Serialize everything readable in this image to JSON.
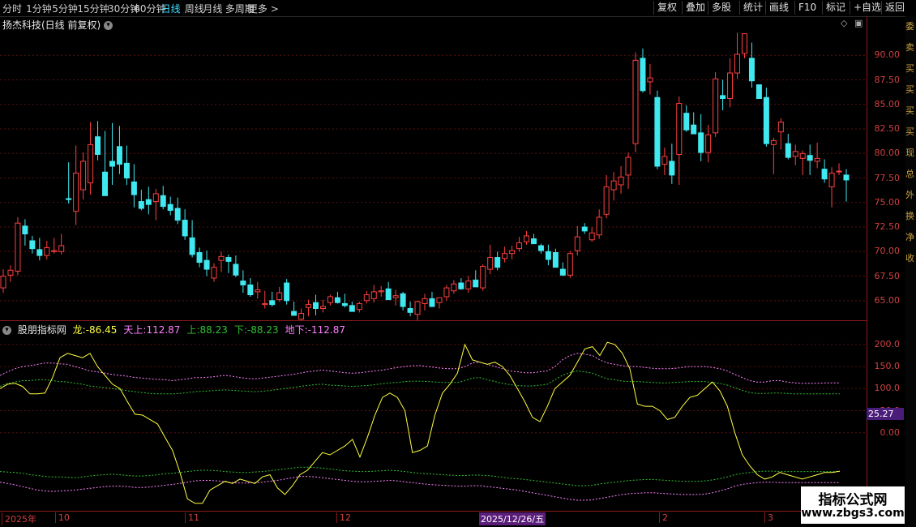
{
  "periods": [
    "分时",
    "1分钟",
    "5分钟",
    "15分钟",
    "30分钟",
    "60分钟",
    "日线",
    "周线",
    "月线",
    "多周期",
    "更多 >"
  ],
  "active_period": "日线",
  "toolbar_right": [
    "复权",
    "叠加",
    "多股",
    "统计",
    "画线",
    "F10",
    "标记",
    "+自选",
    "返回"
  ],
  "stock_title": "扬杰科技(日线 前复权)",
  "price_axis": [
    "90.00",
    "87.50",
    "85.00",
    "82.50",
    "80.00",
    "77.50",
    "75.00",
    "72.50",
    "70.00",
    "67.50",
    "65.00"
  ],
  "indicator": {
    "name": "股朋指标网",
    "items": [
      {
        "label": "龙:",
        "value": "-86.45",
        "color": "#ffff40"
      },
      {
        "label": "天上:",
        "value": "112.87",
        "color": "#ff80ff"
      },
      {
        "label": "上:",
        "value": "88.23",
        "color": "#30c030"
      },
      {
        "label": "下:",
        "value": "-88.23",
        "color": "#30c030"
      },
      {
        "label": "地下:",
        "value": "-112.87",
        "color": "#ff80ff"
      }
    ],
    "axis": [
      "200.0",
      "150.0",
      "100.0",
      "50.0",
      "0.00"
    ],
    "current_value": "25.27"
  },
  "date_axis": [
    {
      "label": "2025年"
    },
    {
      "label": "10"
    },
    {
      "label": "11"
    },
    {
      "label": "12"
    },
    {
      "label": "2"
    },
    {
      "label": "3"
    }
  ],
  "date_selected": "2025/12/26/五",
  "watermark": {
    "line1": "指标公式网",
    "line2": "www.zbgs3.com"
  },
  "colors": {
    "up": "#ff4040",
    "down": "#40e8f0",
    "axis": "#8b1a1a",
    "curve": "#ffff40"
  },
  "far_right_glyphs": [
    "委",
    "卖",
    "买",
    "买",
    "买",
    "买",
    "现",
    "总",
    "外",
    "换",
    "净",
    "收"
  ],
  "chart_data": {
    "type": "candlestick",
    "ylim": [
      63,
      92.5
    ],
    "candles": [
      [
        66.3,
        68.2,
        65.8,
        67.5
      ],
      [
        67.6,
        68.6,
        66.9,
        68.1
      ],
      [
        68.0,
        73.5,
        67.6,
        72.9
      ],
      [
        72.6,
        73.3,
        70.6,
        71.8
      ],
      [
        71.1,
        71.6,
        69.8,
        70.3
      ],
      [
        70.2,
        71.4,
        69.1,
        69.6
      ],
      [
        69.6,
        71.1,
        69.2,
        70.4
      ],
      [
        70.0,
        71.4,
        69.8,
        70.1
      ],
      [
        70.0,
        71.8,
        69.7,
        70.6
      ],
      [
        75.4,
        79.1,
        74.9,
        75.3
      ],
      [
        74.1,
        80.8,
        72.7,
        78.0
      ],
      [
        76.3,
        80.1,
        75.3,
        79.2
      ],
      [
        77.0,
        83.2,
        75.8,
        80.9
      ],
      [
        81.7,
        83.3,
        79.3,
        79.9
      ],
      [
        78.1,
        82.3,
        76.9,
        75.7
      ],
      [
        79.2,
        83.1,
        76.8,
        78.7
      ],
      [
        80.7,
        82.8,
        77.9,
        78.9
      ],
      [
        79.0,
        80.8,
        76.8,
        77.5
      ],
      [
        77.1,
        78.9,
        74.5,
        75.8
      ],
      [
        75.1,
        76.3,
        74.2,
        74.4
      ],
      [
        75.3,
        76.6,
        73.8,
        74.8
      ],
      [
        75.1,
        76.4,
        73.2,
        75.9
      ],
      [
        75.7,
        76.7,
        74.3,
        74.6
      ],
      [
        74.8,
        75.6,
        73.7,
        74.2
      ],
      [
        74.4,
        75.5,
        72.8,
        73.2
      ],
      [
        73.2,
        74.3,
        71.2,
        71.6
      ],
      [
        71.4,
        73.2,
        69.4,
        69.7
      ],
      [
        69.9,
        70.4,
        68.4,
        68.9
      ],
      [
        69.1,
        70.1,
        67.5,
        68.2
      ],
      [
        67.3,
        68.8,
        66.9,
        68.4
      ],
      [
        69.1,
        70.0,
        67.9,
        69.5
      ],
      [
        69.4,
        69.7,
        67.8,
        69.0
      ],
      [
        68.7,
        69.6,
        67.4,
        67.6
      ],
      [
        67.0,
        68.1,
        65.8,
        66.6
      ],
      [
        66.6,
        67.3,
        65.4,
        65.6
      ],
      [
        65.9,
        66.9,
        65.2,
        66.1
      ],
      [
        64.6,
        66.0,
        64.2,
        64.7
      ],
      [
        65.0,
        65.9,
        64.4,
        64.6
      ],
      [
        65.1,
        66.4,
        64.9,
        65.8
      ],
      [
        66.8,
        67.2,
        64.6,
        65.0
      ],
      [
        63.9,
        64.9,
        63.7,
        63.5
      ],
      [
        63.1,
        64.2,
        62.7,
        63.7
      ],
      [
        64.3,
        65.1,
        63.4,
        64.6
      ],
      [
        64.8,
        65.6,
        63.5,
        64.2
      ],
      [
        64.2,
        65.1,
        63.8,
        64.4
      ],
      [
        64.8,
        65.6,
        64.5,
        65.4
      ],
      [
        65.3,
        65.9,
        64.7,
        64.8
      ],
      [
        64.7,
        65.7,
        64.3,
        64.5
      ],
      [
        64.5,
        64.9,
        63.9,
        63.9
      ],
      [
        64.1,
        64.9,
        63.8,
        64.7
      ],
      [
        65.0,
        66.0,
        64.7,
        65.6
      ],
      [
        65.2,
        66.6,
        64.8,
        65.9
      ],
      [
        65.9,
        66.5,
        65.4,
        66.0
      ],
      [
        66.2,
        66.9,
        65.5,
        65.1
      ],
      [
        65.3,
        66.1,
        64.5,
        65.5
      ],
      [
        65.7,
        65.9,
        64.0,
        64.4
      ],
      [
        64.2,
        64.9,
        63.4,
        63.8
      ],
      [
        63.6,
        65.0,
        62.8,
        64.9
      ],
      [
        64.7,
        65.7,
        64.0,
        65.2
      ],
      [
        65.2,
        65.9,
        64.6,
        64.4
      ],
      [
        64.8,
        65.3,
        64.2,
        65.3
      ],
      [
        65.4,
        66.6,
        65.0,
        66.3
      ],
      [
        66.0,
        67.1,
        65.7,
        66.7
      ],
      [
        66.8,
        67.3,
        66.1,
        66.2
      ],
      [
        66.2,
        67.5,
        65.8,
        67.0
      ],
      [
        67.1,
        68.1,
        66.6,
        66.4
      ],
      [
        66.3,
        68.7,
        66.0,
        68.5
      ],
      [
        68.2,
        70.7,
        67.7,
        69.4
      ],
      [
        69.4,
        70.0,
        68.1,
        68.4
      ],
      [
        69.3,
        70.5,
        68.9,
        69.8
      ],
      [
        69.8,
        70.6,
        69.2,
        70.1
      ],
      [
        70.3,
        71.5,
        70.0,
        70.9
      ],
      [
        71.0,
        72.1,
        70.7,
        71.6
      ],
      [
        71.3,
        71.8,
        70.8,
        70.8
      ],
      [
        70.6,
        70.8,
        69.8,
        70.1
      ],
      [
        70.0,
        70.7,
        68.6,
        69.2
      ],
      [
        69.9,
        70.3,
        68.8,
        68.4
      ],
      [
        68.2,
        68.9,
        67.5,
        67.6
      ],
      [
        67.6,
        70.1,
        67.3,
        69.8
      ],
      [
        70.1,
        72.6,
        69.6,
        71.5
      ],
      [
        72.5,
        72.9,
        71.8,
        72.1
      ],
      [
        71.2,
        72.5,
        71.0,
        71.9
      ],
      [
        71.7,
        74.3,
        71.3,
        73.5
      ],
      [
        73.8,
        77.8,
        73.4,
        76.6
      ],
      [
        76.3,
        78.1,
        75.2,
        77.2
      ],
      [
        76.8,
        78.7,
        75.9,
        77.6
      ],
      [
        77.8,
        80.1,
        76.4,
        79.6
      ],
      [
        81.0,
        90.3,
        80.1,
        89.5
      ],
      [
        89.7,
        90.7,
        86.2,
        86.4
      ],
      [
        87.3,
        89.1,
        86.0,
        87.7
      ],
      [
        85.7,
        86.4,
        78.4,
        78.7
      ],
      [
        78.9,
        80.6,
        77.8,
        79.7
      ],
      [
        79.2,
        81.0,
        76.9,
        77.8
      ],
      [
        79.9,
        85.8,
        76.8,
        85.1
      ],
      [
        84.1,
        84.9,
        82.2,
        82.4
      ],
      [
        82.9,
        84.2,
        82.1,
        82.0
      ],
      [
        82.1,
        84.0,
        79.2,
        80.1
      ],
      [
        80.1,
        82.9,
        79.1,
        81.9
      ],
      [
        82.1,
        88.3,
        81.7,
        87.6
      ],
      [
        85.9,
        87.5,
        84.4,
        85.6
      ],
      [
        85.6,
        89.7,
        84.7,
        88.2
      ],
      [
        88.2,
        92.3,
        87.6,
        90.1
      ],
      [
        90.2,
        91.0,
        89.7,
        92.2
      ],
      [
        89.7,
        91.3,
        86.7,
        87.4
      ],
      [
        87.0,
        86.8,
        85.8,
        85.6
      ],
      [
        85.7,
        86.7,
        80.7,
        81.0
      ],
      [
        80.9,
        81.6,
        77.9,
        81.3
      ],
      [
        82.2,
        83.6,
        80.4,
        83.2
      ],
      [
        81.0,
        82.0,
        79.4,
        79.6
      ],
      [
        79.7,
        80.9,
        78.8,
        80.2
      ],
      [
        79.5,
        80.3,
        77.8,
        80.0
      ],
      [
        79.8,
        80.9,
        77.8,
        79.3
      ],
      [
        79.2,
        81.1,
        78.5,
        79.5
      ],
      [
        78.4,
        79.4,
        77.0,
        77.4
      ],
      [
        76.6,
        78.6,
        74.5,
        78.0
      ],
      [
        78.2,
        79.0,
        77.8,
        78.2
      ],
      [
        77.8,
        78.4,
        75.1,
        77.3
      ]
    ],
    "oscillator": {
      "ylim": [
        -175,
        220
      ],
      "main": [
        100,
        110,
        112,
        105,
        88,
        88,
        90,
        125,
        170,
        180,
        175,
        170,
        180,
        150,
        130,
        110,
        100,
        70,
        42,
        40,
        30,
        20,
        -10,
        -40,
        -90,
        -150,
        -160,
        -160,
        -130,
        -120,
        -110,
        -115,
        -105,
        -110,
        -115,
        -100,
        -95,
        -125,
        -140,
        -120,
        -95,
        -85,
        -65,
        -45,
        -50,
        -40,
        -30,
        -15,
        -55,
        -10,
        40,
        80,
        90,
        80,
        50,
        -45,
        -40,
        -30,
        40,
        90,
        110,
        135,
        200,
        165,
        160,
        155,
        160,
        150,
        130,
        100,
        70,
        35,
        25,
        60,
        100,
        115,
        130,
        160,
        190,
        195,
        175,
        205,
        200,
        180,
        145,
        65,
        60,
        60,
        50,
        30,
        35,
        60,
        80,
        85,
        100,
        115,
        95,
        60,
        0,
        -50,
        -75,
        -95,
        -105,
        -100,
        -90,
        -95,
        -100,
        -105,
        -100,
        -95,
        -90,
        -90,
        -87
      ],
      "upper_outer": [
        130,
        138,
        145,
        150,
        152,
        155,
        158,
        158,
        156,
        155,
        150,
        145,
        140,
        138,
        135,
        132,
        130,
        128,
        125,
        124,
        122,
        121,
        120,
        118,
        120,
        122,
        125,
        125,
        126,
        128,
        130,
        128,
        125,
        123,
        122,
        124,
        126,
        128,
        130,
        132,
        135,
        138,
        140,
        142,
        140,
        138,
        136,
        135,
        136,
        138,
        140,
        142,
        145,
        148,
        150,
        152,
        152,
        150,
        148,
        146,
        145,
        145,
        150,
        158,
        160,
        155,
        150,
        145,
        140,
        138,
        136,
        136,
        138,
        140,
        150,
        165,
        175,
        180,
        178,
        175,
        165,
        158,
        155,
        152,
        150,
        150,
        148,
        146,
        145,
        145,
        146,
        148,
        150,
        150,
        150,
        148,
        145,
        140,
        132,
        125,
        118,
        115,
        115,
        118,
        118,
        115,
        113,
        112,
        112,
        112,
        113,
        113,
        113
      ],
      "upper_inner": [
        105,
        112,
        115,
        118,
        118,
        120,
        120,
        118,
        116,
        115,
        112,
        110,
        106,
        104,
        102,
        100,
        98,
        95,
        93,
        91,
        89,
        88,
        88,
        88,
        89,
        91,
        93,
        94,
        95,
        96,
        97,
        96,
        95,
        94,
        93,
        94,
        96,
        98,
        100,
        102,
        105,
        107,
        109,
        110,
        108,
        107,
        106,
        105,
        106,
        107,
        109,
        111,
        113,
        114,
        116,
        117,
        117,
        116,
        115,
        114,
        114,
        114,
        118,
        124,
        125,
        120,
        116,
        112,
        109,
        107,
        106,
        106,
        108,
        110,
        120,
        130,
        136,
        140,
        138,
        135,
        128,
        122,
        120,
        117,
        116,
        116,
        115,
        114,
        113,
        113,
        114,
        115,
        116,
        116,
        116,
        114,
        112,
        108,
        102,
        96,
        91,
        89,
        89,
        90,
        90,
        89,
        88,
        88,
        88,
        88,
        88,
        88,
        88
      ],
      "lower_inner": [
        -88,
        -89,
        -90,
        -92,
        -95,
        -97,
        -99,
        -100,
        -100,
        -101,
        -102,
        -100,
        -98,
        -96,
        -95,
        -94,
        -95,
        -97,
        -98,
        -98,
        -97,
        -95,
        -93,
        -92,
        -90,
        -88,
        -86,
        -85,
        -85,
        -86,
        -88,
        -89,
        -90,
        -90,
        -89,
        -88,
        -86,
        -84,
        -82,
        -80,
        -78,
        -78,
        -79,
        -80,
        -82,
        -84,
        -86,
        -87,
        -88,
        -88,
        -87,
        -86,
        -85,
        -86,
        -88,
        -90,
        -92,
        -93,
        -94,
        -95,
        -96,
        -97,
        -97,
        -96,
        -96,
        -97,
        -99,
        -101,
        -103,
        -104,
        -106,
        -108,
        -110,
        -112,
        -114,
        -116,
        -118,
        -120,
        -120,
        -119,
        -116,
        -114,
        -112,
        -110,
        -108,
        -107,
        -106,
        -106,
        -107,
        -108,
        -109,
        -110,
        -110,
        -110,
        -109,
        -107,
        -104,
        -100,
        -95,
        -92,
        -90,
        -88,
        -87,
        -87,
        -88,
        -88,
        -88,
        -88,
        -88,
        -88,
        -88,
        -88,
        -88
      ],
      "lower_outer": [
        -112,
        -115,
        -118,
        -122,
        -126,
        -130,
        -132,
        -133,
        -132,
        -131,
        -130,
        -128,
        -126,
        -124,
        -122,
        -121,
        -121,
        -122,
        -124,
        -124,
        -123,
        -121,
        -119,
        -117,
        -115,
        -112,
        -109,
        -108,
        -108,
        -109,
        -111,
        -113,
        -114,
        -114,
        -113,
        -112,
        -110,
        -108,
        -105,
        -102,
        -99,
        -99,
        -100,
        -102,
        -104,
        -106,
        -108,
        -110,
        -111,
        -111,
        -110,
        -109,
        -108,
        -109,
        -111,
        -113,
        -115,
        -117,
        -118,
        -119,
        -120,
        -121,
        -121,
        -120,
        -120,
        -122,
        -124,
        -126,
        -128,
        -130,
        -133,
        -136,
        -139,
        -142,
        -145,
        -148,
        -151,
        -153,
        -153,
        -152,
        -149,
        -146,
        -143,
        -140,
        -138,
        -137,
        -136,
        -136,
        -137,
        -138,
        -139,
        -140,
        -140,
        -140,
        -139,
        -136,
        -132,
        -127,
        -121,
        -117,
        -115,
        -113,
        -112,
        -112,
        -113,
        -113,
        -113,
        -113,
        -113,
        -113,
        -113,
        -113,
        -113
      ]
    }
  }
}
